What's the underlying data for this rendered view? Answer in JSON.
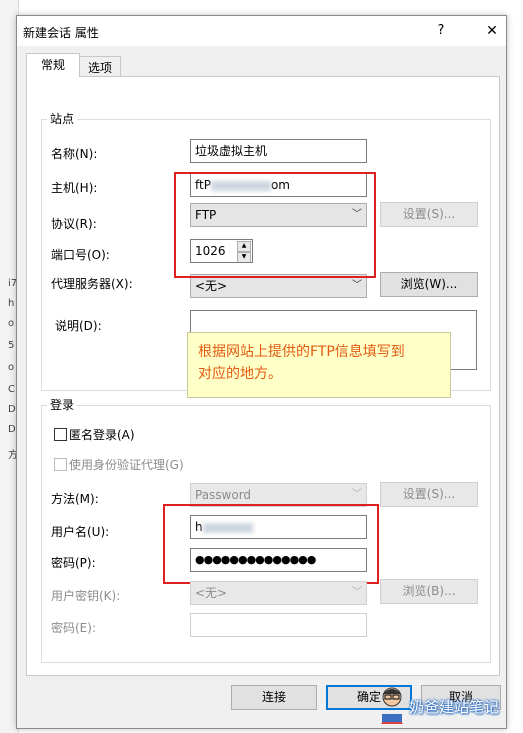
{
  "window": {
    "title": "新建会话 属性",
    "help_glyph": "?",
    "close_glyph": "✕"
  },
  "tabs": [
    {
      "label": "常规"
    },
    {
      "label": "选项"
    }
  ],
  "site": {
    "legend": "站点",
    "name": {
      "label": "名称(N):",
      "value": "垃圾虚拟主机"
    },
    "host": {
      "label": "主机(H):",
      "prefix": "ftP",
      "suffix": "om"
    },
    "protocol": {
      "label": "协议(R):",
      "value": "FTP",
      "settings_button": "设置(S)..."
    },
    "port": {
      "label": "端口号(O):",
      "value": "1026"
    },
    "proxy": {
      "label": "代理服务器(X):",
      "value": "<无>",
      "browse_button": "浏览(W)..."
    },
    "description": {
      "label": "说明(D):",
      "value": ""
    }
  },
  "tooltip": {
    "line1": "根据网站上提供的FTP信息填写到",
    "line2": "对应的地方。"
  },
  "login": {
    "legend": "登录",
    "anonymous": {
      "label": "匿名登录(A)",
      "checked": false
    },
    "auth_agent": {
      "label": "使用身份验证代理(G)",
      "checked": false
    },
    "method": {
      "label": "方法(M):",
      "value": "Password",
      "settings_button": "设置(S)..."
    },
    "username": {
      "label": "用户名(U):",
      "prefix": "h"
    },
    "password": {
      "label": "密码(P):",
      "value": "●●●●●●●●●●●●●●"
    },
    "user_key": {
      "label": "用户密钥(K):",
      "value": "<无>",
      "browse_button": "浏览(B)..."
    },
    "passphrase": {
      "label": "密码(E):",
      "value": ""
    }
  },
  "footer": {
    "connect_button": "连接",
    "ok_button": "确定",
    "cancel_button": "取消"
  },
  "watermark": {
    "text": "奶爸建站笔记"
  },
  "colors": {
    "highlight_box": "#e02020",
    "tooltip_bg": "#ffffc8",
    "tooltip_text": "#e25b12",
    "accent": "#0078d7"
  }
}
